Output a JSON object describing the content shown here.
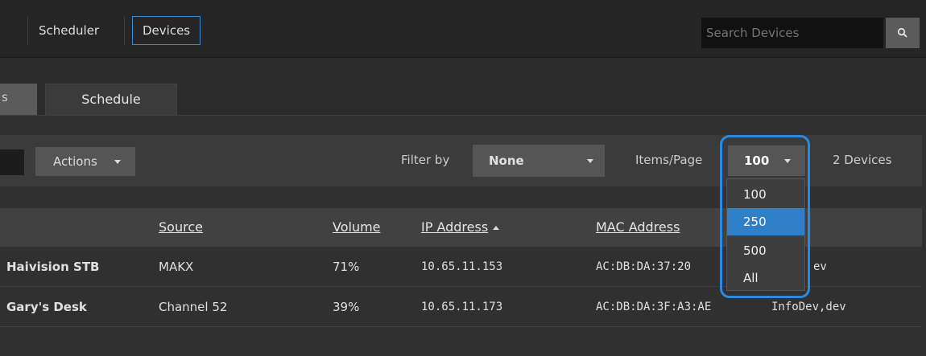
{
  "nav": {
    "items": [
      {
        "label": "Scheduler",
        "active": false
      },
      {
        "label": "Devices",
        "active": true
      }
    ],
    "search_placeholder": "Search Devices",
    "search_icon": "search-icon"
  },
  "tabs": [
    {
      "label": "s",
      "active": false
    },
    {
      "label": "Schedule",
      "active": true
    }
  ],
  "toolbar": {
    "actions_label": "Actions",
    "filter_label": "Filter by",
    "filter_value": "None",
    "items_label": "Items/Page",
    "items_value": "100",
    "devices_count": "2 Devices"
  },
  "items_dropdown": {
    "options": [
      "100",
      "250",
      "500",
      "All"
    ],
    "highlighted": "250"
  },
  "table": {
    "columns": [
      "Source",
      "Volume",
      "IP Address",
      "MAC Address"
    ],
    "sorted_column": "IP Address",
    "rows": [
      {
        "name": "Haivision STB",
        "source": "MAKX",
        "volume": "71%",
        "ip": "10.65.11.153",
        "mac": "AC:DB:DA:37:20",
        "tags": "ev"
      },
      {
        "name": "Gary's Desk",
        "source": "Channel 52",
        "volume": "39%",
        "ip": "10.65.11.173",
        "mac": "AC:DB:DA:3F:A3:AE",
        "tags": "InfoDev,dev"
      }
    ]
  },
  "colors": {
    "accent": "#2b8ae0",
    "selected": "#2f80c8",
    "background": "#2b2b2b"
  }
}
